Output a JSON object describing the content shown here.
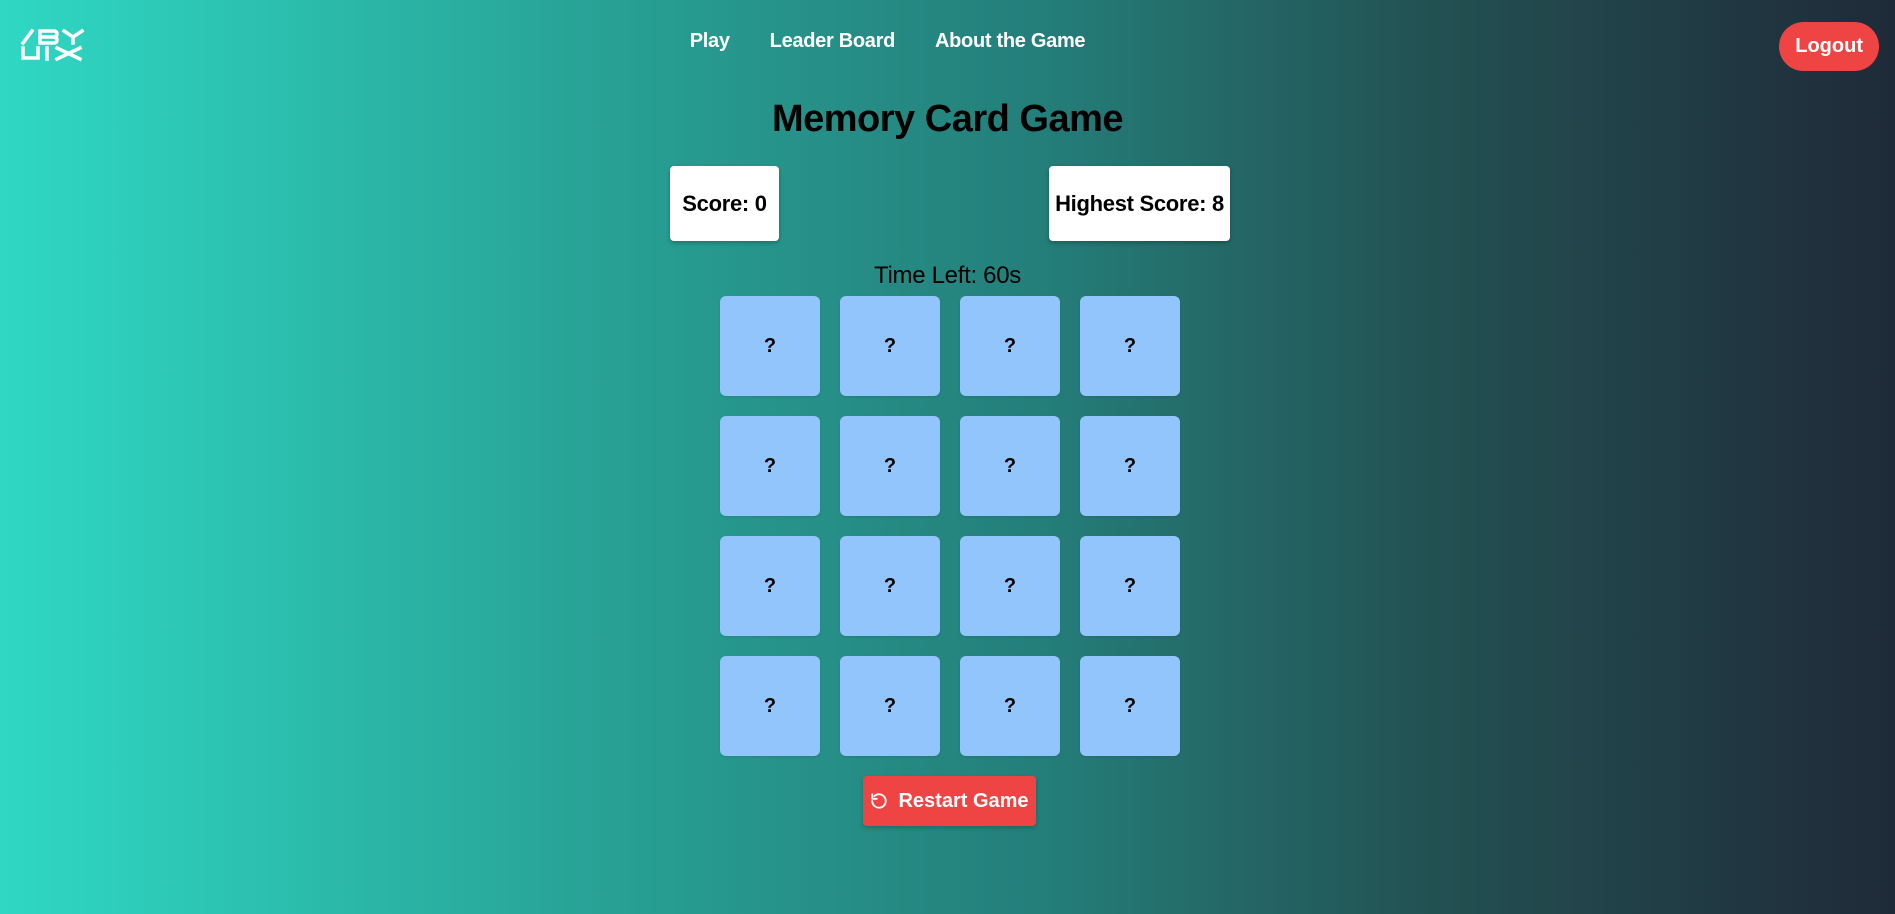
{
  "header": {
    "logo_text": "/BY UIX",
    "nav": [
      {
        "label": "Play"
      },
      {
        "label": "Leader Board"
      },
      {
        "label": "About the Game"
      }
    ],
    "logout_label": "Logout"
  },
  "game": {
    "title": "Memory Card Game",
    "score_label": "Score: 0",
    "score_value": 0,
    "highest_score_label": "Highest Score: 8",
    "highest_score_value": 8,
    "time_left_label": "Time Left: 60s",
    "time_left_seconds": 60,
    "cards": [
      "?",
      "?",
      "?",
      "?",
      "?",
      "?",
      "?",
      "?",
      "?",
      "?",
      "?",
      "?",
      "?",
      "?",
      "?",
      "?"
    ],
    "restart_label": "Restart Game",
    "restart_icon": "rotate-ccw-icon"
  },
  "colors": {
    "card_back": "#93c5fd",
    "accent_red": "#ef4444",
    "gradient_start": "#2fd8c4",
    "gradient_end": "#1f2a38"
  }
}
